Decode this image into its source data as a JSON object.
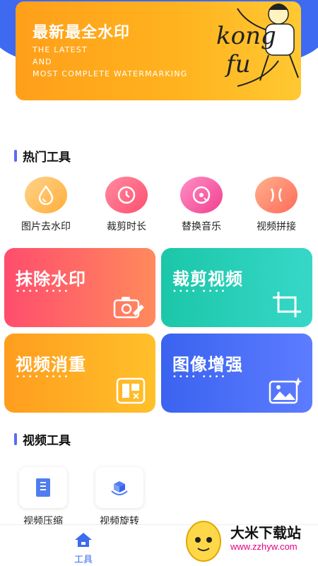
{
  "banner": {
    "title": "最新最全水印",
    "sub1": "THE LATEST",
    "sub2": "AND",
    "sub3": "MOST COMPLETE WATERMARKING",
    "art_text": "kong fu"
  },
  "hot_tools": {
    "title": "热门工具",
    "items": [
      {
        "label": "图片去水印",
        "icon": "droplet-icon"
      },
      {
        "label": "裁剪时长",
        "icon": "clock-icon"
      },
      {
        "label": "替换音乐",
        "icon": "music-disc-icon"
      },
      {
        "label": "视频拼接",
        "icon": "join-icon"
      }
    ]
  },
  "cards": [
    {
      "title": "抹除水印",
      "dots": "•••• ••••",
      "icon": "camera-eraser-icon",
      "color_from": "#ff4d6d",
      "color_to": "#ff8a5c"
    },
    {
      "title": "裁剪视频",
      "dots": "•••• ••••",
      "icon": "crop-icon",
      "color_from": "#1bc7a8",
      "color_to": "#37d7c8"
    },
    {
      "title": "视频消重",
      "dots": "•••• ••••",
      "icon": "dedupe-icon",
      "color_from": "#ff9d1e",
      "color_to": "#ffc02a"
    },
    {
      "title": "图像增强",
      "dots": "•••• ••••",
      "icon": "image-enhance-icon",
      "color_from": "#3a63f0",
      "color_to": "#5d7cff"
    }
  ],
  "video_tools": {
    "title": "视频工具",
    "items": [
      {
        "label": "视频压缩",
        "icon": "compress-icon"
      },
      {
        "label": "视频旋转",
        "icon": "rotate-cube-icon"
      }
    ]
  },
  "tabbar": {
    "tools_label": "工具"
  },
  "watermark": {
    "name": "大米下载站",
    "url": "www.zzhyw.com"
  }
}
